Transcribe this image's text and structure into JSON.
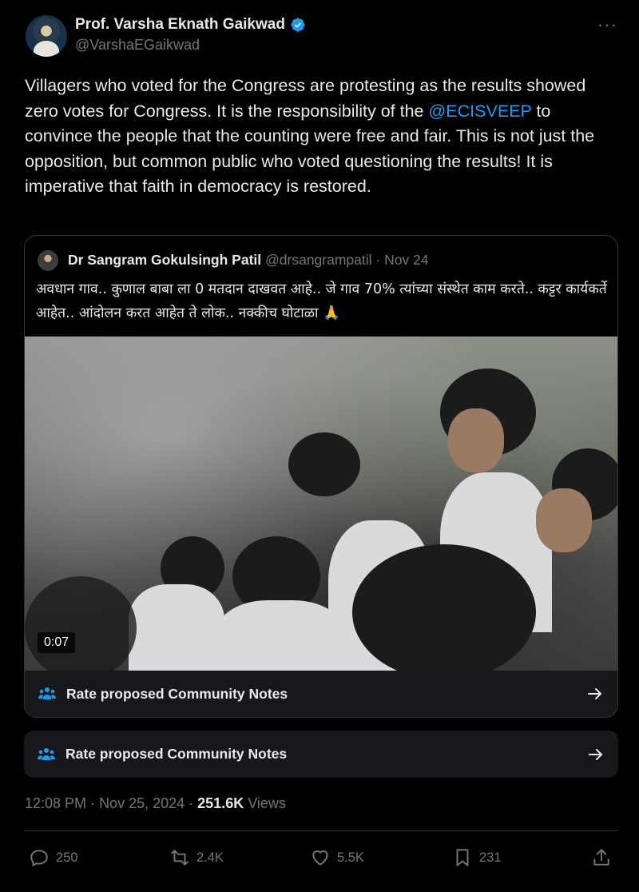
{
  "author": {
    "name": "Prof. Varsha Eknath Gaikwad",
    "handle": "@VarshaEGaikwad"
  },
  "tweet": {
    "text_before": "Villagers who voted for the Congress are protesting as the results showed zero votes for Congress. It is the responsibility of the ",
    "mention": "@ECISVEEP",
    "text_after": " to convince the people that the counting were free and fair. This is not just the opposition, but common public who voted questioning the results! It is imperative that faith in democracy is restored."
  },
  "quote": {
    "name": "Dr Sangram Gokulsingh Patil",
    "handle": "@drsangrampatil",
    "date": "· Nov 24",
    "text": "अवधान गाव.. कुणाल बाबा ला 0 मतदान दाखवत आहे.. जे गाव 70% त्यांच्या संस्थेत काम करते.. कट्टर कार्यकर्ते आहेत.. आंदोलन करत आहेत ते लोक.. नक्कीच घोटाळा 🙏",
    "video_duration": "0:07",
    "notes_label": "Rate proposed Community Notes"
  },
  "notes": {
    "label": "Rate proposed Community Notes"
  },
  "meta": {
    "time": "12:08 PM",
    "date": "Nov 25, 2024",
    "views_count": "251.6K",
    "views_label": "Views"
  },
  "actions": {
    "replies": "250",
    "retweets": "2.4K",
    "likes": "5.5K",
    "bookmarks": "231"
  },
  "colors": {
    "accent": "#1d9bf0",
    "background": "#000000",
    "muted": "#71767b",
    "card": "#16181c"
  }
}
